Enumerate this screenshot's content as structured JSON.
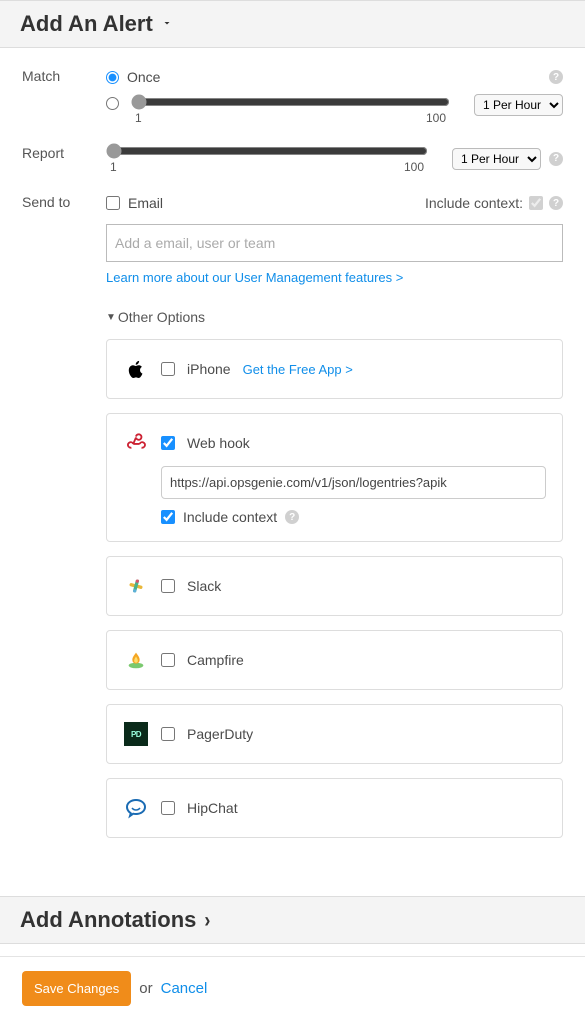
{
  "alertPanel": {
    "title": "Add An Alert"
  },
  "match": {
    "label": "Match",
    "once_label": "Once",
    "slider_min": "1",
    "slider_max": "100",
    "freq_selected": "1 Per Hour"
  },
  "report": {
    "label": "Report",
    "slider_min": "1",
    "slider_max": "100",
    "freq_selected": "1 Per Hour"
  },
  "sendto": {
    "label": "Send to",
    "email_label": "Email",
    "include_context_label": "Include context:",
    "email_placeholder": "Add a email, user or team",
    "learn_more": "Learn more about our User Management features >"
  },
  "other": {
    "toggle_label": "Other Options",
    "iphone": {
      "label": "iPhone",
      "get_app": "Get the Free App >"
    },
    "webhook": {
      "label": "Web hook",
      "url": "https://api.opsgenie.com/v1/json/logentries?apik",
      "include_context_label": "Include context"
    },
    "slack": {
      "label": "Slack"
    },
    "campfire": {
      "label": "Campfire"
    },
    "pagerduty": {
      "label": "PagerDuty"
    },
    "hipchat": {
      "label": "HipChat"
    }
  },
  "annotationsPanel": {
    "title": "Add Annotations"
  },
  "footer": {
    "save": "Save Changes",
    "or": "or",
    "cancel": "Cancel"
  }
}
